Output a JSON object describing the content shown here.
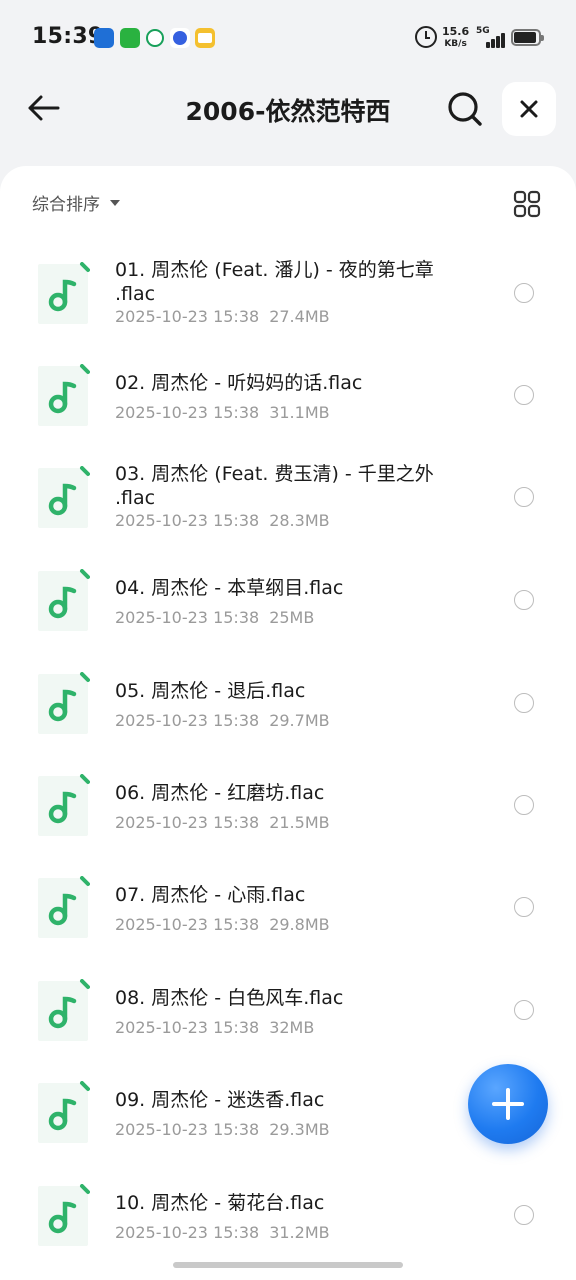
{
  "status_bar": {
    "time": "15:39",
    "net_speed_value": "15.6",
    "net_speed_unit": "KB/s",
    "network": "5G",
    "notification_icons": [
      "baidu-netdisk-icon",
      "wechat-icon",
      "app-icon",
      "baidu-icon",
      "mail-icon"
    ]
  },
  "header": {
    "title": "2006-依然范特西"
  },
  "toolbar": {
    "sort_label": "综合排序"
  },
  "files": [
    {
      "name": "01. 周杰伦 (Feat. 潘儿) - 夜的第七章\n.flac",
      "date": "2025-10-23 15:38",
      "size": "27.4MB"
    },
    {
      "name": "02. 周杰伦 - 听妈妈的话.flac",
      "date": "2025-10-23 15:38",
      "size": "31.1MB"
    },
    {
      "name": "03. 周杰伦 (Feat. 费玉清) - 千里之外\n.flac",
      "date": "2025-10-23 15:38",
      "size": "28.3MB"
    },
    {
      "name": "04. 周杰伦 - 本草纲目.flac",
      "date": "2025-10-23 15:38",
      "size": "25MB"
    },
    {
      "name": "05. 周杰伦 - 退后.flac",
      "date": "2025-10-23 15:38",
      "size": "29.7MB"
    },
    {
      "name": "06. 周杰伦 - 红磨坊.flac",
      "date": "2025-10-23 15:38",
      "size": "21.5MB"
    },
    {
      "name": "07. 周杰伦 - 心雨.flac",
      "date": "2025-10-23 15:38",
      "size": "29.8MB"
    },
    {
      "name": "08. 周杰伦 - 白色风车.flac",
      "date": "2025-10-23 15:38",
      "size": "32MB"
    },
    {
      "name": "09. 周杰伦 - 迷迭香.flac",
      "date": "2025-10-23 15:38",
      "size": "29.3MB"
    },
    {
      "name": "10. 周杰伦 - 菊花台.flac",
      "date": "2025-10-23 15:38",
      "size": "31.2MB"
    }
  ],
  "colors": {
    "accent": "#1f7bf0",
    "music_icon": "#2fb36a",
    "background": "#f2f3f5"
  }
}
